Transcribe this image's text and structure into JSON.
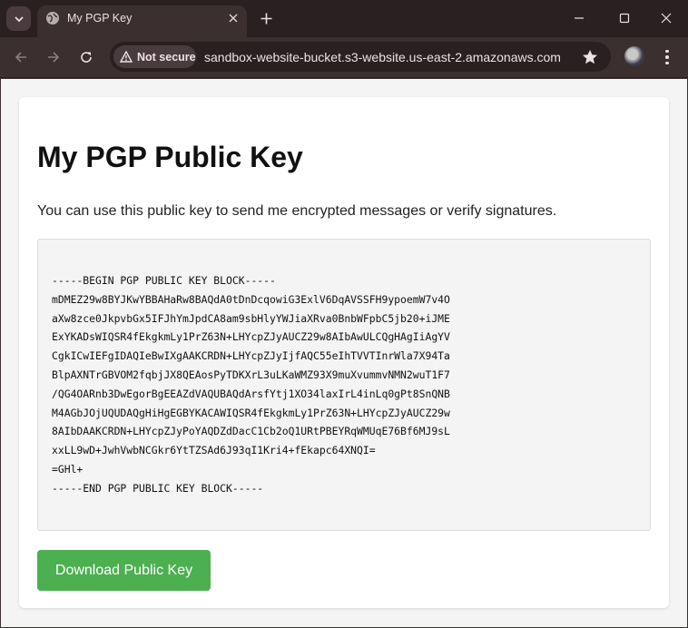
{
  "tab": {
    "title": "My PGP Key"
  },
  "toolbar": {
    "security_label": "Not secure",
    "url": "sandbox-website-bucket.s3-website.us-east-2.amazonaws.com"
  },
  "page": {
    "heading": "My PGP Public Key",
    "description": "You can use this public key to send me encrypted messages or verify signatures.",
    "public_key": "-----BEGIN PGP PUBLIC KEY BLOCK-----\nmDMEZ29w8BYJKwYBBAHaRw8BAQdA0tDnDcqowiG3ExlV6DqAVSSFH9ypoemW7v4O\naXw8zce0JkpvbGx5IFJhYmJpdCA8am9sbHlyYWJiaXRva0BnbWFpbC5jb20+iJME\nExYKADsWIQSR4fEkgkmLy1PrZ63N+LHYcpZJyAUCZ29w8AIbAwULCQgHAgIiAgYV\nCgkICwIEFgIDAQIeBwIXgAAKCRDN+LHYcpZJyIjfAQC55eIhTVVTInrWla7X94Ta\nBlpAXNTrGBVOM2fqbjJX8QEAosPyTDKXrL3uLKaWMZ93X9muXvummvNMN2wuT1F7\n/QG4OARnb3DwEgorBgEEAZdVAQUBAQdArsfYtj1XO34laxIrL4inLq0gPt8SnQNB\nM4AGbJOjUQUDAQgHiHgEGBYKACAWIQSR4fEkgkmLy1PrZ63N+LHYcpZJyAUCZ29w\n8AIbDAAKCRDN+LHYcpZJyPoYAQDZdDacC1Cb2oQ1URtPBEYRqWMUqE76Bf6MJ9sL\nxxLL9wD+JwhVwbNCGkr6YtTZSAd6J93qI1Kri4+fEkapc64XNQI=\n=GHl+\n-----END PGP PUBLIC KEY BLOCK-----",
    "download_label": "Download Public Key"
  },
  "colors": {
    "accent_button": "#4caf50",
    "chrome_dark": "#2a1f21",
    "chrome_toolbar": "#3b2f30"
  },
  "icons": [
    "tab-search-icon",
    "globe-icon",
    "close-icon",
    "plus-icon",
    "minimize-icon",
    "maximize-icon",
    "window-close-icon",
    "back-arrow-icon",
    "forward-arrow-icon",
    "reload-icon",
    "warning-icon",
    "star-icon",
    "avatar",
    "kebab-menu-icon"
  ]
}
